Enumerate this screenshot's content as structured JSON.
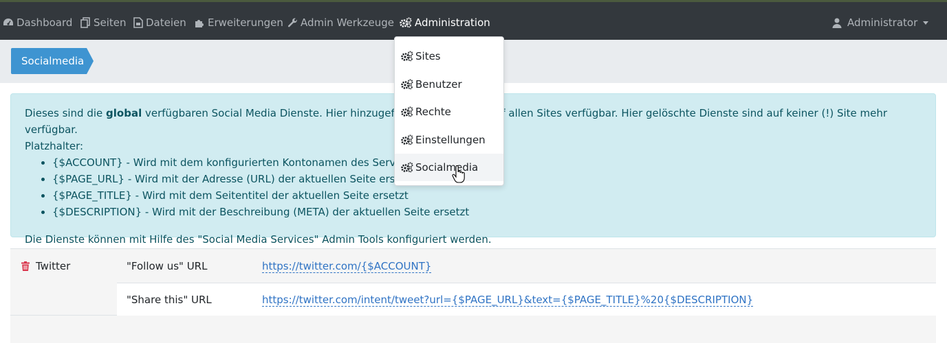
{
  "navbar": {
    "items": [
      {
        "label": "Dashboard",
        "icon": "dashboard-icon"
      },
      {
        "label": "Seiten",
        "icon": "pages-icon"
      },
      {
        "label": "Dateien",
        "icon": "files-icon"
      },
      {
        "label": "Erweiterungen",
        "icon": "puzzle-icon"
      },
      {
        "label": "Admin Werkzeuge",
        "icon": "wrench-icon"
      },
      {
        "label": "Administration",
        "icon": "gears-icon"
      }
    ],
    "user_label": "Administrator"
  },
  "breadcrumb": {
    "label": "Socialmedia"
  },
  "dropdown": {
    "items": [
      {
        "label": "Sites"
      },
      {
        "label": "Benutzer"
      },
      {
        "label": "Rechte"
      },
      {
        "label": "Einstellungen"
      },
      {
        "label": "Socialmedia"
      }
    ]
  },
  "info": {
    "intro_before": "Dieses sind die ",
    "intro_bold": "global",
    "intro_after": " verfügbaren Social Media Dienste. Hier hinzugefügte Dienste sind auf allen Sites verfügbar. Hier gelöschte Dienste sind auf keiner (!) Site mehr verfügbar.",
    "placeholder_heading": "Platzhalter:",
    "placeholders": [
      "{$ACCOUNT} - Wird mit dem konfigurierten Kontonamen des Service ersetzt",
      "{$PAGE_URL} - Wird mit der Adresse (URL) der aktuellen Seite ersetzt",
      "{$PAGE_TITLE} - Wird mit dem Seitentitel der aktuellen Seite ersetzt",
      "{$DESCRIPTION} - Wird mit der Beschreibung (META) der aktuellen Seite ersetzt"
    ],
    "note": "Die Dienste können mit Hilfe des \"Social Media Services\" Admin Tools konfiguriert werden."
  },
  "services": [
    {
      "name": "Twitter",
      "follow_label": "\"Follow us\" URL",
      "follow_url": "https://twitter.com/{$ACCOUNT}",
      "share_label": "\"Share this\" URL",
      "share_url": "https://twitter.com/intent/tweet?url={$PAGE_URL}&text={$PAGE_TITLE}%20{$DESCRIPTION}"
    }
  ],
  "colors": {
    "navbar": "#33383d",
    "accent": "#3e94d1",
    "alert_bg": "#d1ecf1",
    "alert_text": "#0c5460",
    "delete": "#d9364d",
    "link": "#2f73c4"
  }
}
